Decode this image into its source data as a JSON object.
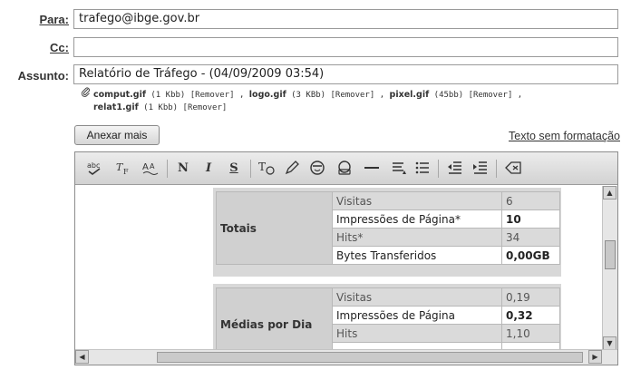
{
  "form": {
    "to_label": "Para:",
    "to_value": "trafego@ibge.gov.br",
    "cc_label": "Cc:",
    "cc_value": "",
    "subject_label": "Assunto:",
    "subject_value": "Relatório de Tráfego - (04/09/2009 03:54)"
  },
  "attachments": [
    {
      "name": "comput.gif",
      "size": "(1 Kbb)",
      "remove": "[Remover]",
      "sep": ","
    },
    {
      "name": "logo.gif",
      "size": "(3 KBb)",
      "remove": "[Remover]",
      "sep": ","
    },
    {
      "name": "pixel.gif",
      "size": "(45bb)",
      "remove": "[Remover]",
      "sep": ","
    },
    {
      "name": "relat1.gif",
      "size": "(1 Kbb)",
      "remove": "[Remover]",
      "sep": ""
    }
  ],
  "buttons": {
    "attach_more": "Anexar mais",
    "plain_text": "Texto sem formatação"
  },
  "toolbar": {
    "bold": "N",
    "italic": "I",
    "underline": "S"
  },
  "report": {
    "totals": {
      "title": "Totais",
      "rows": [
        {
          "label": "Visitas",
          "value": "6"
        },
        {
          "label": "Impressões de Página*",
          "value": "10"
        },
        {
          "label": "Hits*",
          "value": "34"
        },
        {
          "label": "Bytes Transferidos",
          "value": "0,00GB"
        }
      ]
    },
    "daily": {
      "title": "Médias por Dia",
      "rows": [
        {
          "label": "Visitas",
          "value": "0,19"
        },
        {
          "label": "Impressões de Página",
          "value": "0,32"
        },
        {
          "label": "Hits",
          "value": "1,10"
        }
      ]
    }
  }
}
